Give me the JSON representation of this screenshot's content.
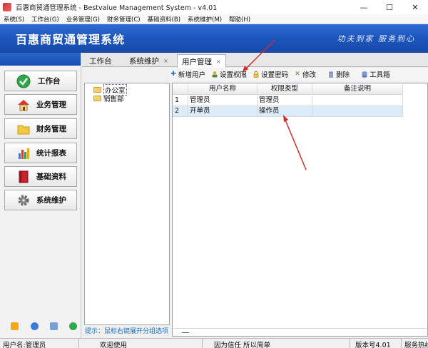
{
  "window": {
    "title": "百惠商贸通管理系统 - Bestvalue Management System - v4.01",
    "minimize": "—",
    "maximize": "☐",
    "close": "✕"
  },
  "menu": [
    "系统(S)",
    "工作台(G)",
    "业务管理(G)",
    "财务管理(C)",
    "基础资料(B)",
    "系统维护(M)",
    "帮助(H)"
  ],
  "banner": {
    "title": "百惠商贸通管理系统",
    "slogan": "功夫到家 服务到心"
  },
  "nav": {
    "items": [
      {
        "label": "工作台",
        "icon": "check-icon"
      },
      {
        "label": "业务管理",
        "icon": "house-icon"
      },
      {
        "label": "财务管理",
        "icon": "folder-icon"
      },
      {
        "label": "统计报表",
        "icon": "bar-chart-icon"
      },
      {
        "label": "基础资料",
        "icon": "book-icon"
      },
      {
        "label": "系统维护",
        "icon": "gear-icon"
      }
    ]
  },
  "tabs": [
    {
      "label": "工作台"
    },
    {
      "label": "系统维护",
      "close": "×"
    },
    {
      "label": "用户管理",
      "close": "×"
    }
  ],
  "toolbar": {
    "add_user": "新增用户",
    "set_permission": "设置权限",
    "set_password": "设置密码",
    "edit": "修改",
    "delete": "删除",
    "toolbox": "工具箱"
  },
  "tree": [
    {
      "label": "办公室"
    },
    {
      "label": "销售部"
    }
  ],
  "hint": "提示：鼠标右键展开分组选项",
  "grid": {
    "headers": [
      "用户名称",
      "权限类型",
      "备注说明"
    ],
    "rows": [
      {
        "no": "1",
        "name": "管理员",
        "role": "管理员",
        "note": ""
      },
      {
        "no": "2",
        "name": "开单员",
        "role": "操作员",
        "note": ""
      }
    ]
  },
  "status": {
    "user": "用户名:管理员",
    "welcome": "欢迎使用",
    "motto": "因为信任 所以简单",
    "version": "版本号4.01",
    "service": "服务热线"
  },
  "colors": {
    "banner": "#1c55bd",
    "annotation": "#d62a2a",
    "hint": "#1a6fc2"
  }
}
